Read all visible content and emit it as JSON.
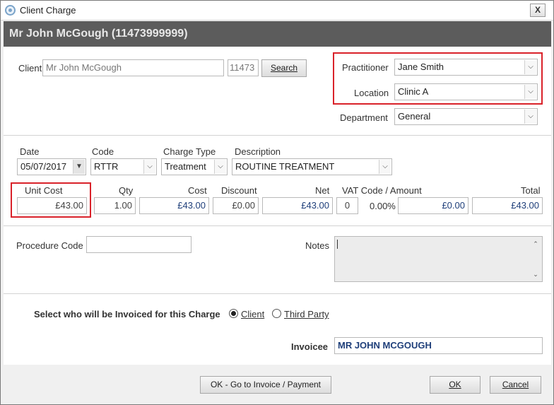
{
  "window": {
    "title": "Client Charge",
    "close_label": "X",
    "header": "Mr John McGough (11473999999)"
  },
  "client_section": {
    "client_label": "Client",
    "client_value": "Mr John McGough",
    "client_id": "11473",
    "search_label": "Search",
    "practitioner_label": "Practitioner",
    "practitioner_value": "Jane Smith",
    "location_label": "Location",
    "location_value": "Clinic A",
    "department_label": "Department",
    "department_value": "General"
  },
  "charge": {
    "date_label": "Date",
    "date_value": "05/07/2017",
    "code_label": "Code",
    "code_value": "RTTR",
    "charge_type_label": "Charge Type",
    "charge_type_value": "Treatment",
    "description_label": "Description",
    "description_value": "ROUTINE TREATMENT",
    "unit_cost_label": "Unit Cost",
    "unit_cost_value": "£43.00",
    "qty_label": "Qty",
    "qty_value": "1.00",
    "cost_label": "Cost",
    "cost_value": "£43.00",
    "discount_label": "Discount",
    "discount_value": "£0.00",
    "net_label": "Net",
    "net_value": "£43.00",
    "vat_label": "VAT Code / Amount",
    "vat_code_value": "0",
    "vat_rate_value": "0.00%",
    "vat_amount_value": "£0.00",
    "total_label": "Total",
    "total_value": "£43.00"
  },
  "extra": {
    "procedure_code_label": "Procedure Code",
    "procedure_code_value": "",
    "notes_label": "Notes",
    "notes_value": ""
  },
  "invoice": {
    "question_label": "Select who will be Invoiced for this Charge",
    "option_client": "Client",
    "option_third_party": "Third Party",
    "selected": "Client",
    "invoicee_label": "Invoicee",
    "invoicee_value": "MR JOHN MCGOUGH"
  },
  "footer": {
    "go_to_invoice_label": "OK - Go to Invoice / Payment",
    "ok_label": "OK",
    "cancel_label": "Cancel"
  },
  "colors": {
    "highlight": "#d9222a",
    "header_band": "#5c5c5c",
    "value_blue": "#1f3f7a"
  }
}
